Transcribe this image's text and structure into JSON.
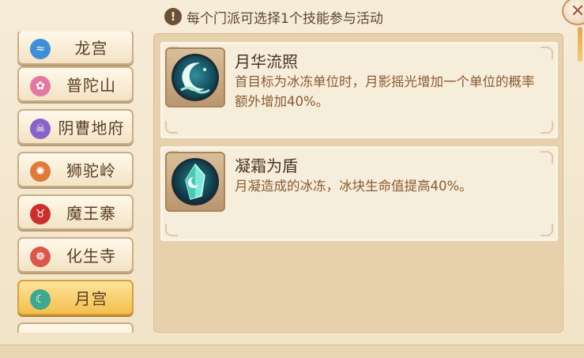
{
  "notice": {
    "text": "每个门派可选择1个技能参与活动"
  },
  "close": {
    "glyph": "✕"
  },
  "sidebar": {
    "items": [
      {
        "label": "龙宫",
        "icon": "dragon-wave-icon",
        "color": "#3f8fd6",
        "active": false
      },
      {
        "label": "普陀山",
        "icon": "lotus-icon",
        "color": "#e07aa2",
        "active": false
      },
      {
        "label": "阴曹地府",
        "icon": "skull-icon",
        "color": "#8a63c9",
        "active": false
      },
      {
        "label": "狮驼岭",
        "icon": "lion-claw-icon",
        "color": "#e07a3a",
        "active": false
      },
      {
        "label": "魔王寨",
        "icon": "demon-bull-icon",
        "color": "#c9302c",
        "active": false
      },
      {
        "label": "化生寺",
        "icon": "dharma-wheel-icon",
        "color": "#d9584a",
        "active": false
      },
      {
        "label": "月宫",
        "icon": "moon-icon",
        "color": "#3fa88e",
        "active": true
      }
    ]
  },
  "skills": [
    {
      "name": "月华流照",
      "icon": "crescent-moon-icon",
      "description": "首目标为冰冻单位时，月影摇光增加一个单位的概率额外增加40%。"
    },
    {
      "name": "凝霜为盾",
      "icon": "ice-crystal-icon",
      "description": "月凝造成的冰冻，冰块生命值提高40%。"
    }
  ],
  "colors": {
    "accent_active": "#f4bf4d",
    "text_brown": "#5a3d25",
    "desc_orange_brown": "#8a5a32"
  }
}
